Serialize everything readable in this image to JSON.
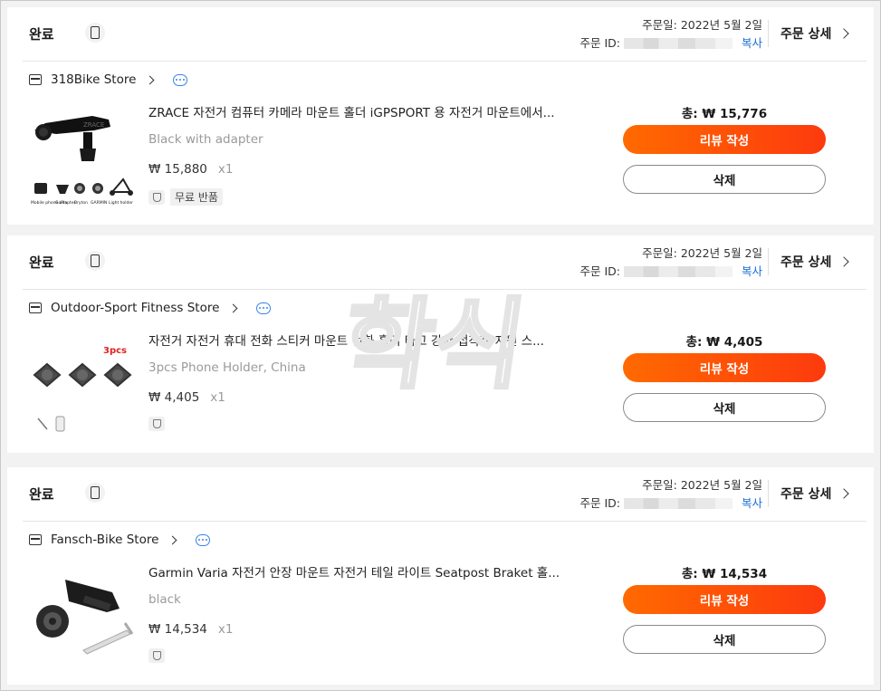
{
  "common": {
    "status": "완료",
    "order_date_label": "주문일:",
    "order_id_label": "주문 ID:",
    "copy_label": "복사",
    "detail_label": "주문 상세",
    "review_label": "리뷰 작성",
    "delete_label": "삭제",
    "free_return": "무료 반품"
  },
  "orders": [
    {
      "order_date": "2022년 5월 2일",
      "store": "318Bike Store",
      "title": "ZRACE 자전거 컴퓨터 카메라 마운트 홀더 iGPSPORT 용 자전거 마운트에서...",
      "variant": "Black with adapter",
      "price": "₩ 15,880",
      "qty": "x1",
      "total": "총: ₩ 15,776",
      "thumb_captions": [
        "Mobile phone adapter",
        "GoPro",
        "Bryton",
        "GARMIN",
        "Light holder"
      ]
    },
    {
      "order_date": "2022년 5월 2일",
      "store": "Outdoor-Sport Fitness Store",
      "title": "자전거 자전거 휴대 전화 스티커 마운트 전화 홀더 타고 강한 접착제 지원 스...",
      "variant": "3pcs Phone Holder, China",
      "price": "₩ 4,405",
      "qty": "x1",
      "total": "총: ₩ 4,405",
      "thumb_caption": "3pcs"
    },
    {
      "order_date": "2022년 5월 2일",
      "store": "Fansch-Bike Store",
      "title": "Garmin Varia 자전거 안장 마운트 자전거 테일 라이트 Seatpost Braket 홀...",
      "variant": "black",
      "price": "₩ 14,534",
      "qty": "x1",
      "total": "총: ₩ 14,534"
    }
  ],
  "watermark": "학식"
}
